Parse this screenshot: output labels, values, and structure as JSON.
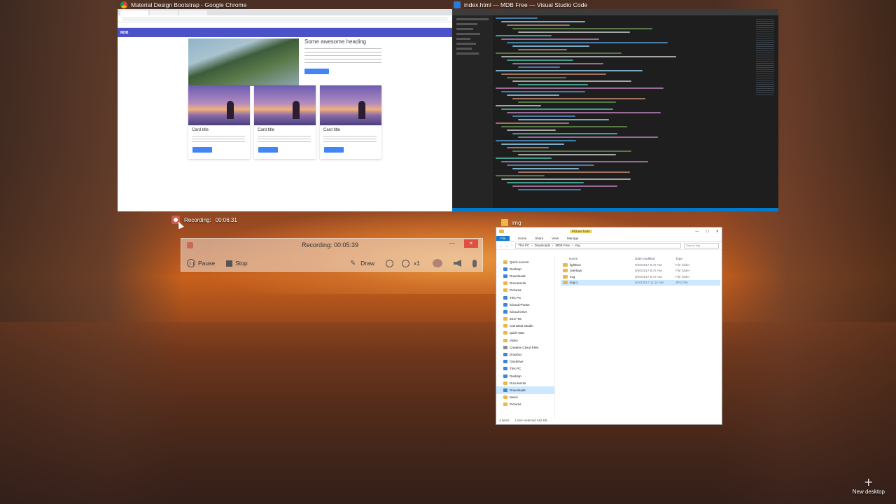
{
  "task_view": {
    "new_desktop_label": "New desktop"
  },
  "chrome": {
    "window_title": "Material Design Bootstrap - Google Chrome",
    "site": {
      "hero_heading": "Some awesome heading",
      "cards": [
        {
          "title": "Card title"
        },
        {
          "title": "Card title"
        },
        {
          "title": "Card title"
        }
      ]
    }
  },
  "vscode": {
    "window_title": "index.html — MDB Free — Visual Studio Code"
  },
  "explorer": {
    "window_title": "img",
    "ribbon_context_tab": "Picture Tools",
    "ribbon_tabs": [
      "File",
      "Home",
      "Share",
      "View",
      "Manage"
    ],
    "breadcrumb": [
      "This PC",
      "Downloads",
      "MDB Free",
      "img"
    ],
    "search_placeholder": "Search img",
    "columns": [
      "Name",
      "Date modified",
      "Type"
    ],
    "files": [
      {
        "name": "lightbox",
        "date": "9/20/2017 8:47 AM",
        "type": "File folder"
      },
      {
        "name": "overlays",
        "date": "9/20/2017 8:47 AM",
        "type": "File folder"
      },
      {
        "name": "svg",
        "date": "9/20/2017 8:47 AM",
        "type": "File folder"
      },
      {
        "name": "img-1",
        "date": "9/20/2017 11:13 AM",
        "type": "JPG File"
      }
    ],
    "nav": [
      {
        "label": "Quick access",
        "icon": "star",
        "selected": false
      },
      {
        "label": "Desktop",
        "icon": "folder-blue",
        "selected": false
      },
      {
        "label": "Downloads",
        "icon": "folder-blue",
        "selected": false
      },
      {
        "label": "Documents",
        "icon": "folder",
        "selected": false
      },
      {
        "label": "Pictures",
        "icon": "folder",
        "selected": false
      },
      {
        "label": "This PC",
        "icon": "pc",
        "selected": false
      },
      {
        "label": "iCloud Photos",
        "icon": "folder-blue",
        "selected": false
      },
      {
        "label": "iCloud Drive",
        "icon": "folder-blue",
        "selected": false
      },
      {
        "label": "2017-09",
        "icon": "folder",
        "selected": false
      },
      {
        "label": "Camtasia Studio",
        "icon": "folder",
        "selected": false
      },
      {
        "label": "quick-start",
        "icon": "folder",
        "selected": false
      },
      {
        "label": "Video",
        "icon": "folder",
        "selected": false
      },
      {
        "label": "Creative Cloud Files",
        "icon": "folder-gray",
        "selected": false
      },
      {
        "label": "Dropbox",
        "icon": "folder-blue",
        "selected": false
      },
      {
        "label": "OneDrive",
        "icon": "folder-blue",
        "selected": false
      },
      {
        "label": "This PC",
        "icon": "pc",
        "selected": false
      },
      {
        "label": "Desktop",
        "icon": "folder-blue",
        "selected": false
      },
      {
        "label": "Documents",
        "icon": "folder",
        "selected": false
      },
      {
        "label": "Downloads",
        "icon": "folder-blue",
        "selected": true
      },
      {
        "label": "Music",
        "icon": "folder",
        "selected": false
      },
      {
        "label": "Pictures",
        "icon": "folder",
        "selected": false
      }
    ],
    "status": {
      "count": "4 items",
      "selection": "1 item selected  452 KB"
    }
  },
  "recorder_widget": {
    "label": "Recording:",
    "time": "00:06:31"
  },
  "recorder": {
    "status": "Recording:  00:05:39",
    "close_label": "×",
    "minimize_label": "—",
    "pause_label": "Pause",
    "stop_label": "Stop",
    "draw_label": "Draw",
    "zoom_label": "x1"
  }
}
